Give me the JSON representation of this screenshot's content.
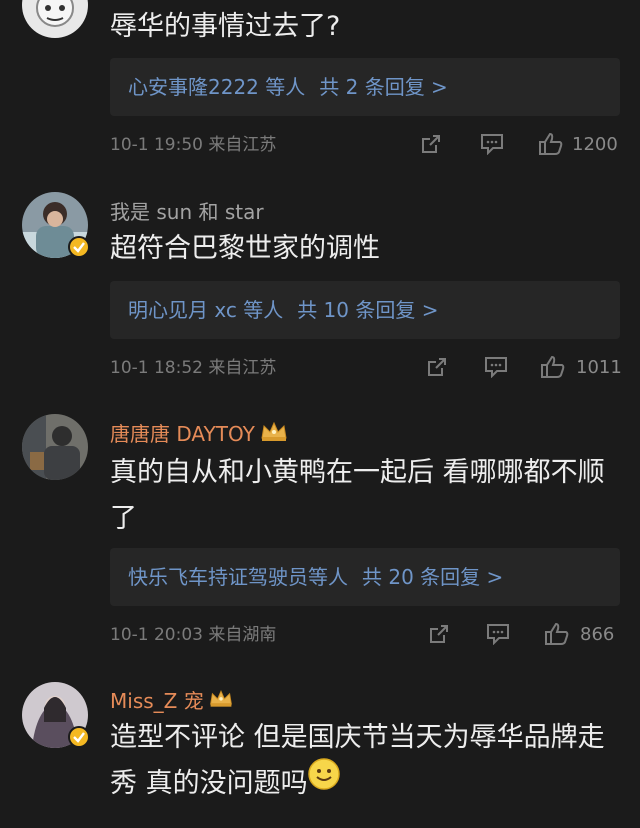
{
  "comments": [
    {
      "username": "",
      "text": "辱华的事情过去了?",
      "replies_summary": "心安事隆2222 等人",
      "replies_count": "共 2 条回复 >",
      "time": "10-1 19:50",
      "location": "来自江苏",
      "likes": "1200"
    },
    {
      "username": "我是 sun 和 star",
      "text": "超符合巴黎世家的调性",
      "replies_summary": "明心见月 xc 等人",
      "replies_count": "共 10 条回复 >",
      "time": "10-1 18:52",
      "location": "来自江苏",
      "likes": "1011"
    },
    {
      "username": "唐唐唐 DAYTOY",
      "text": "真的自从和小黄鸭在一起后 看哪哪都不顺了",
      "replies_summary": "快乐飞车持证驾驶员等人",
      "replies_count": "共 20 条回复 >",
      "time": "10-1 20:03",
      "location": "来自湖南",
      "likes": "866"
    },
    {
      "username": "Miss_Z 宠",
      "text": "造型不评论 但是国庆节当天为辱华品牌走秀 真的没问题吗"
    }
  ],
  "icons": {
    "share": "share-icon",
    "reply": "comment-icon",
    "like": "thumbs-up-icon",
    "crown": "crown-badge-icon",
    "verified": "verified-badge-icon",
    "emoji": "smile-emoji-icon"
  },
  "colors": {
    "background": "#1b1b1b",
    "reply_box": "#262626",
    "link_blue": "#6f95c8",
    "vip_orange": "#e58b58",
    "verified_gold": "#f4b822"
  }
}
